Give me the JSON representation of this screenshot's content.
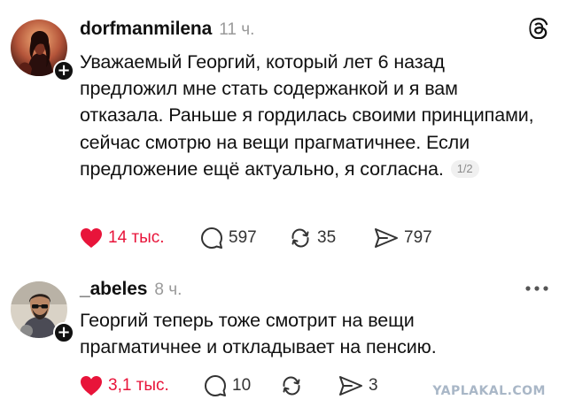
{
  "posts": [
    {
      "username": "dorfmanmilena",
      "time": "11 ч.",
      "text": "Уважаемый Георгий, который лет 6 назад предложил мне стать содержанкой и я вам отказала. Раньше я гордилась своими принципами, сейчас смотрю на вещи прагматичнее. Если предложение ещё актуально, я согласна.",
      "page_badge": "1/2",
      "likes": "14 тыс.",
      "comments": "597",
      "reposts": "35",
      "shares": "797"
    },
    {
      "username": "_abeles",
      "time": "8 ч.",
      "text": "Георгий теперь тоже смотрит на вещи прагматичнее и откладывает на пенсию.",
      "likes": "3,1 тыс.",
      "comments": "10",
      "reposts": "",
      "shares": "3"
    }
  ],
  "watermark": "YAPLAKAL.COM",
  "colors": {
    "like": "#e8143a",
    "muted": "#9a9a9a",
    "text": "#111111"
  },
  "icons": [
    "threads-logo-icon",
    "more-icon",
    "heart-icon",
    "comment-icon",
    "repost-icon",
    "share-icon",
    "plus-icon"
  ]
}
